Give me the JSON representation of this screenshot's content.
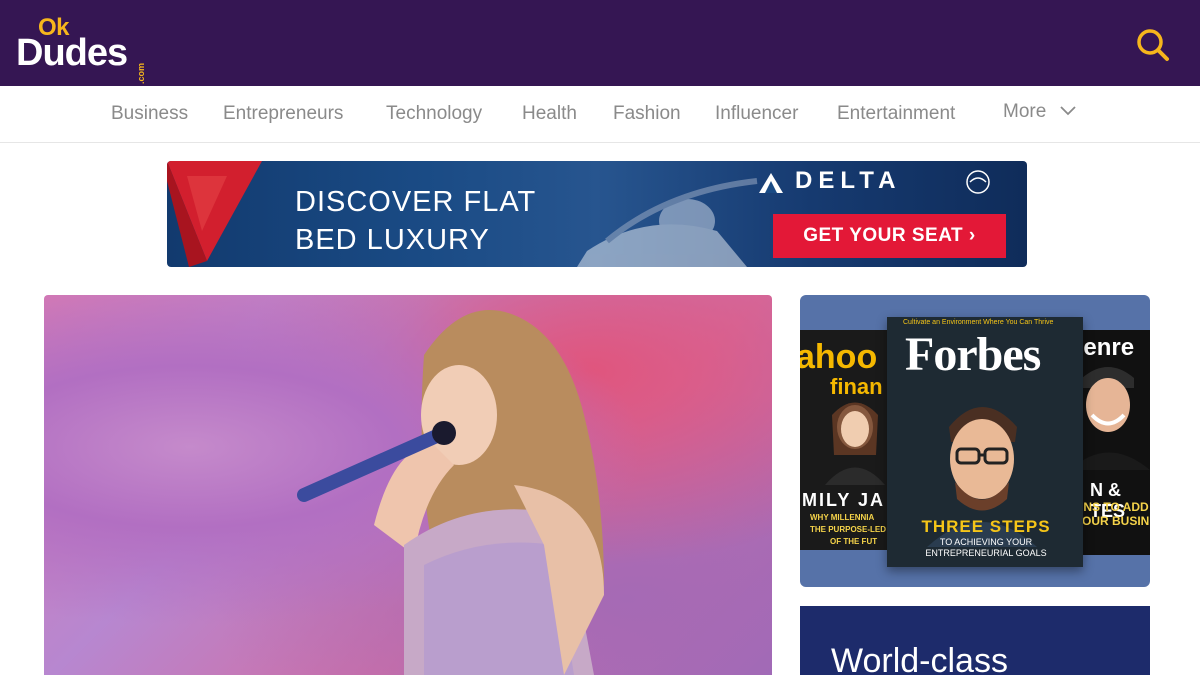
{
  "header": {
    "logo_top": "Ok",
    "logo_main": "Dudes",
    "logo_suffix": ".com",
    "search_icon": "search-icon",
    "colors": {
      "bg": "#351653",
      "accent": "#f6b61c"
    }
  },
  "nav": {
    "items": [
      "Business",
      "Entrepreneurs",
      "Technology",
      "Health",
      "Fashion",
      "Influencer",
      "Entertainment"
    ],
    "more_label": "More",
    "more_icon": "chevron-down-icon"
  },
  "ad": {
    "headline_line1": "DISCOVER FLAT",
    "headline_line2": "BED LUXURY",
    "brand": "DELTA",
    "cta": "GET YOUR SEAT ›",
    "colors": {
      "cta": "#e31837",
      "widget": "#d21f2e"
    }
  },
  "magazines": {
    "main": {
      "kicker": "Cultivate an Environment Where You Can Thrive",
      "title": "Forbes",
      "headline": "THREE STEPS",
      "subline1": "TO ACHIEVING YOUR",
      "subline2": "ENTREPRENEURIAL GOALS"
    },
    "left": {
      "title": "ahoo",
      "subtitle": "finan",
      "name": "MILY JA",
      "sub1": "WHY MILLENNIA",
      "sub2": "THE PURPOSE-LED",
      "sub3": "OF THE FUT"
    },
    "right": {
      "title": "renre",
      "tag1": "N & TES",
      "tag2": "ONS TO ADD B",
      "tag3": "YOUR BUSIN"
    }
  },
  "promo": {
    "text": "World-class"
  }
}
